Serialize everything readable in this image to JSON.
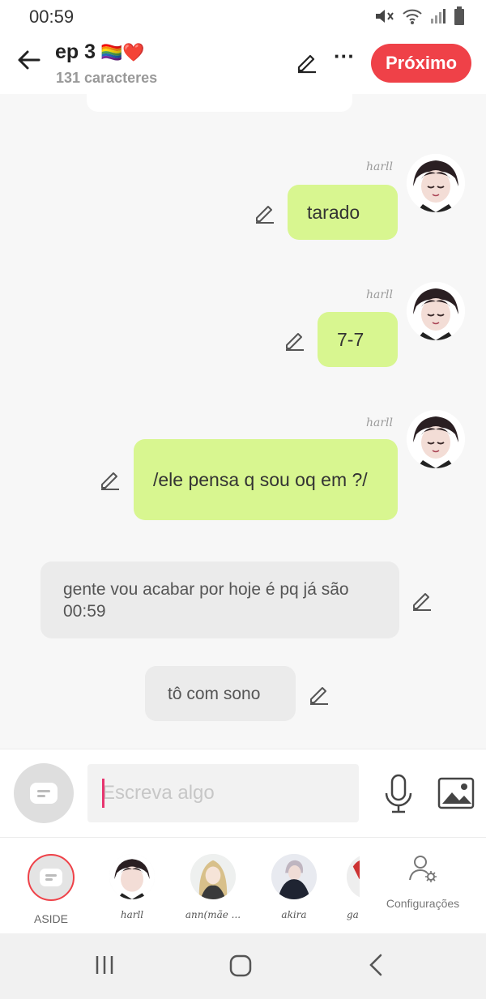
{
  "status_bar": {
    "time": "00:59"
  },
  "header": {
    "title": "ep 3",
    "emoji": "🏳️‍🌈❤️",
    "subtitle": "131 caracteres",
    "next_label": "Próximo"
  },
  "messages": [
    {
      "type": "character",
      "name": "harll",
      "text": "tarado"
    },
    {
      "type": "character",
      "name": "harll",
      "text": "7-7"
    },
    {
      "type": "character",
      "name": "harll",
      "text": "/ele pensa q sou oq em ?/"
    },
    {
      "type": "aside",
      "text": "gente vou acabar por hoje  é pq já são 00:59"
    },
    {
      "type": "aside",
      "text": "tô com sono"
    }
  ],
  "composer": {
    "placeholder": "Escreva algo"
  },
  "characters": [
    {
      "label": "ASIDE"
    },
    {
      "label": "harll"
    },
    {
      "label": "ann(mãe ..."
    },
    {
      "label": "akira"
    },
    {
      "label": "ga"
    }
  ],
  "settings_label": "Configurações",
  "colors": {
    "accent": "#ef4148",
    "bubble_green": "#d8f690",
    "bubble_gray": "#ebebeb"
  }
}
